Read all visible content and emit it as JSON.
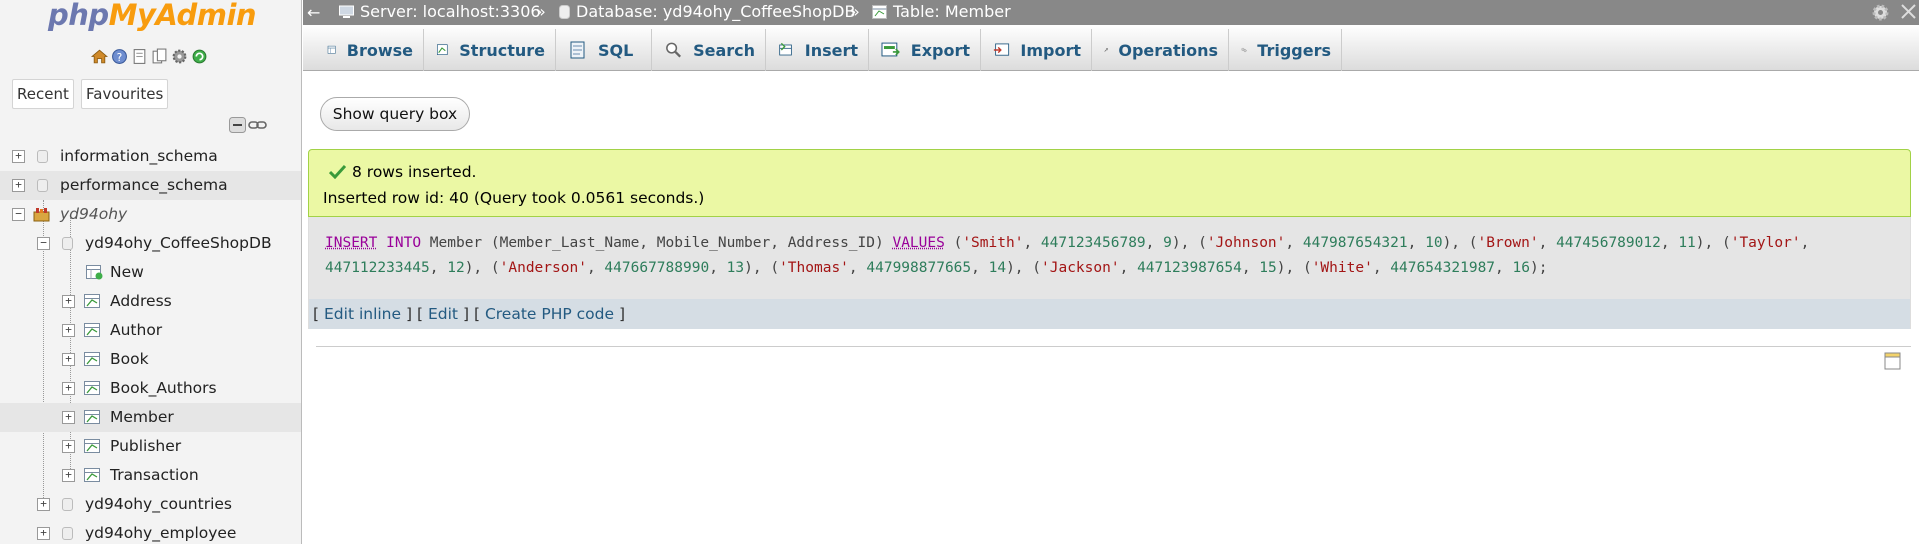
{
  "sidebar": {
    "logo_php": "php",
    "logo_ma": "MyAdmin",
    "quick_icons": [
      "home-icon",
      "info-icon",
      "docs-icon",
      "copy-icon",
      "settings-icon",
      "reload-icon"
    ],
    "recent_label": "Recent",
    "favourites_label": "Favourites",
    "tree": [
      {
        "label": "information_schema"
      },
      {
        "label": "performance_schema"
      },
      {
        "label": "yd94ohy"
      },
      {
        "label": "yd94ohy_CoffeeShopDB"
      },
      {
        "label": "New"
      },
      {
        "label": "Address"
      },
      {
        "label": "Author"
      },
      {
        "label": "Book"
      },
      {
        "label": "Book_Authors"
      },
      {
        "label": "Member"
      },
      {
        "label": "Publisher"
      },
      {
        "label": "Transaction"
      },
      {
        "label": "yd94ohy_countries"
      },
      {
        "label": "yd94ohy_employee"
      }
    ]
  },
  "breadcrumb": {
    "server": "Server: localhost:3306",
    "database": "Database: yd94ohy_CoffeeShopDB",
    "table": "Table: Member",
    "separator": "»",
    "back": "←"
  },
  "tabs": [
    {
      "label": "Browse",
      "icon": "browse-icon"
    },
    {
      "label": "Structure",
      "icon": "structure-icon"
    },
    {
      "label": "SQL",
      "icon": "sql-icon"
    },
    {
      "label": "Search",
      "icon": "search-icon"
    },
    {
      "label": "Insert",
      "icon": "insert-icon"
    },
    {
      "label": "Export",
      "icon": "export-icon"
    },
    {
      "label": "Import",
      "icon": "import-icon"
    },
    {
      "label": "Operations",
      "icon": "operations-icon"
    },
    {
      "label": "Triggers",
      "icon": "triggers-icon"
    }
  ],
  "main": {
    "show_query_label": "Show query box",
    "success_line1": "8 rows inserted.",
    "success_line2": "Inserted row id: 40 (Query took 0.0561 seconds.)",
    "sql_parts": {
      "kw_insert": "INSERT",
      "kw_into": "INTO",
      "table_cols": "Member (Member_Last_Name, Mobile_Number, Address_ID)",
      "kw_values": "VALUES",
      "rows": [
        {
          "name": "'Smith'",
          "mobile": "447123456789",
          "addr": "9"
        },
        {
          "name": "'Johnson'",
          "mobile": "447987654321",
          "addr": "10"
        },
        {
          "name": "'Brown'",
          "mobile": "447456789012",
          "addr": "11"
        },
        {
          "name": "'Taylor'",
          "mobile": "447112233445",
          "addr": "12"
        },
        {
          "name": "'Anderson'",
          "mobile": "447667788990",
          "addr": "13"
        },
        {
          "name": "'Thomas'",
          "mobile": "447998877665",
          "addr": "14"
        },
        {
          "name": "'Jackson'",
          "mobile": "447123987654",
          "addr": "15"
        },
        {
          "name": "'White'",
          "mobile": "447654321987",
          "addr": "16"
        }
      ]
    },
    "links": {
      "open": "[",
      "close": "]",
      "edit_inline": "Edit inline",
      "edit": "Edit",
      "create_php": "Create PHP code"
    }
  },
  "colors": {
    "accent": "#235a81",
    "success_bg": "#ebf8a4",
    "topbar_bg": "#888888"
  }
}
